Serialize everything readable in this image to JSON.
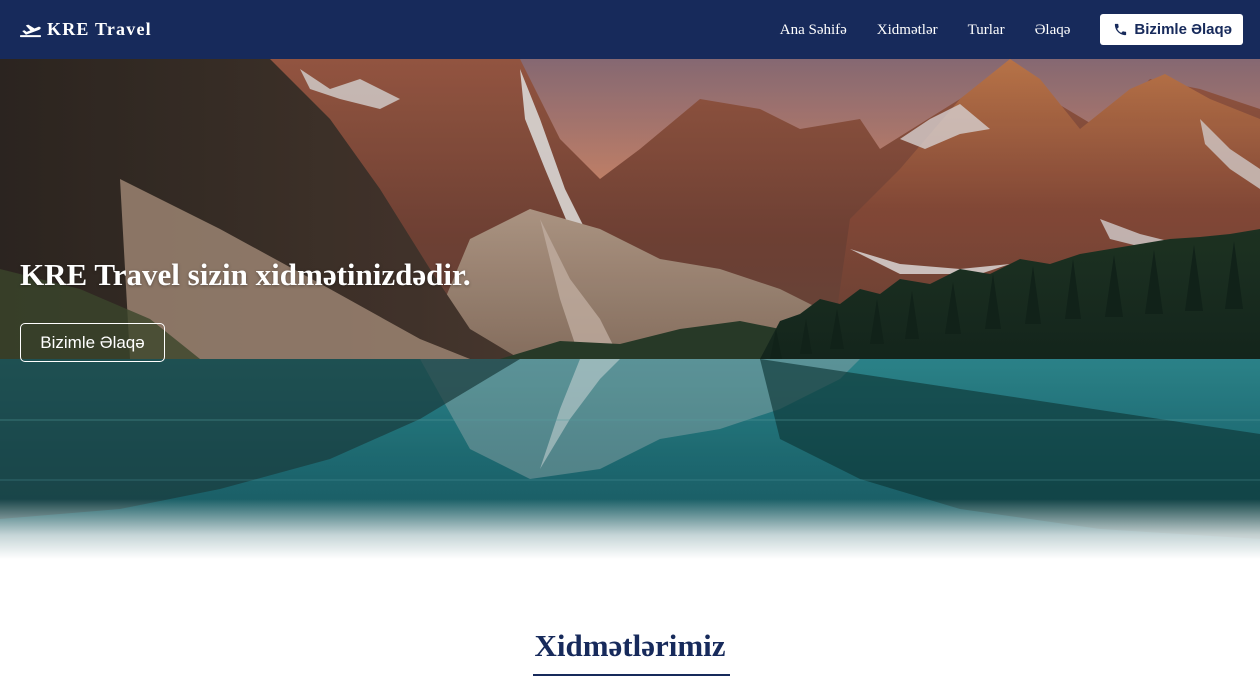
{
  "brand": {
    "icon": "airplane-takeoff-icon",
    "name": "KRE Travel"
  },
  "nav": {
    "links": [
      "Ana Səhifə",
      "Xidmətlər",
      "Turlar",
      "Əlaqə"
    ],
    "cta_icon": "phone-icon",
    "cta_label": "Bizimle Əlaqə"
  },
  "hero": {
    "image": "mountain-lake-landscape",
    "title": "KRE Travel sizin xidmətinizdədir.",
    "button_label": "Bizimle Əlaqə"
  },
  "services": {
    "title": "Xidmətlərimiz"
  },
  "colors": {
    "navbar_bg": "#172a5b",
    "accent": "#172a5b",
    "text_light": "#ffffff"
  }
}
